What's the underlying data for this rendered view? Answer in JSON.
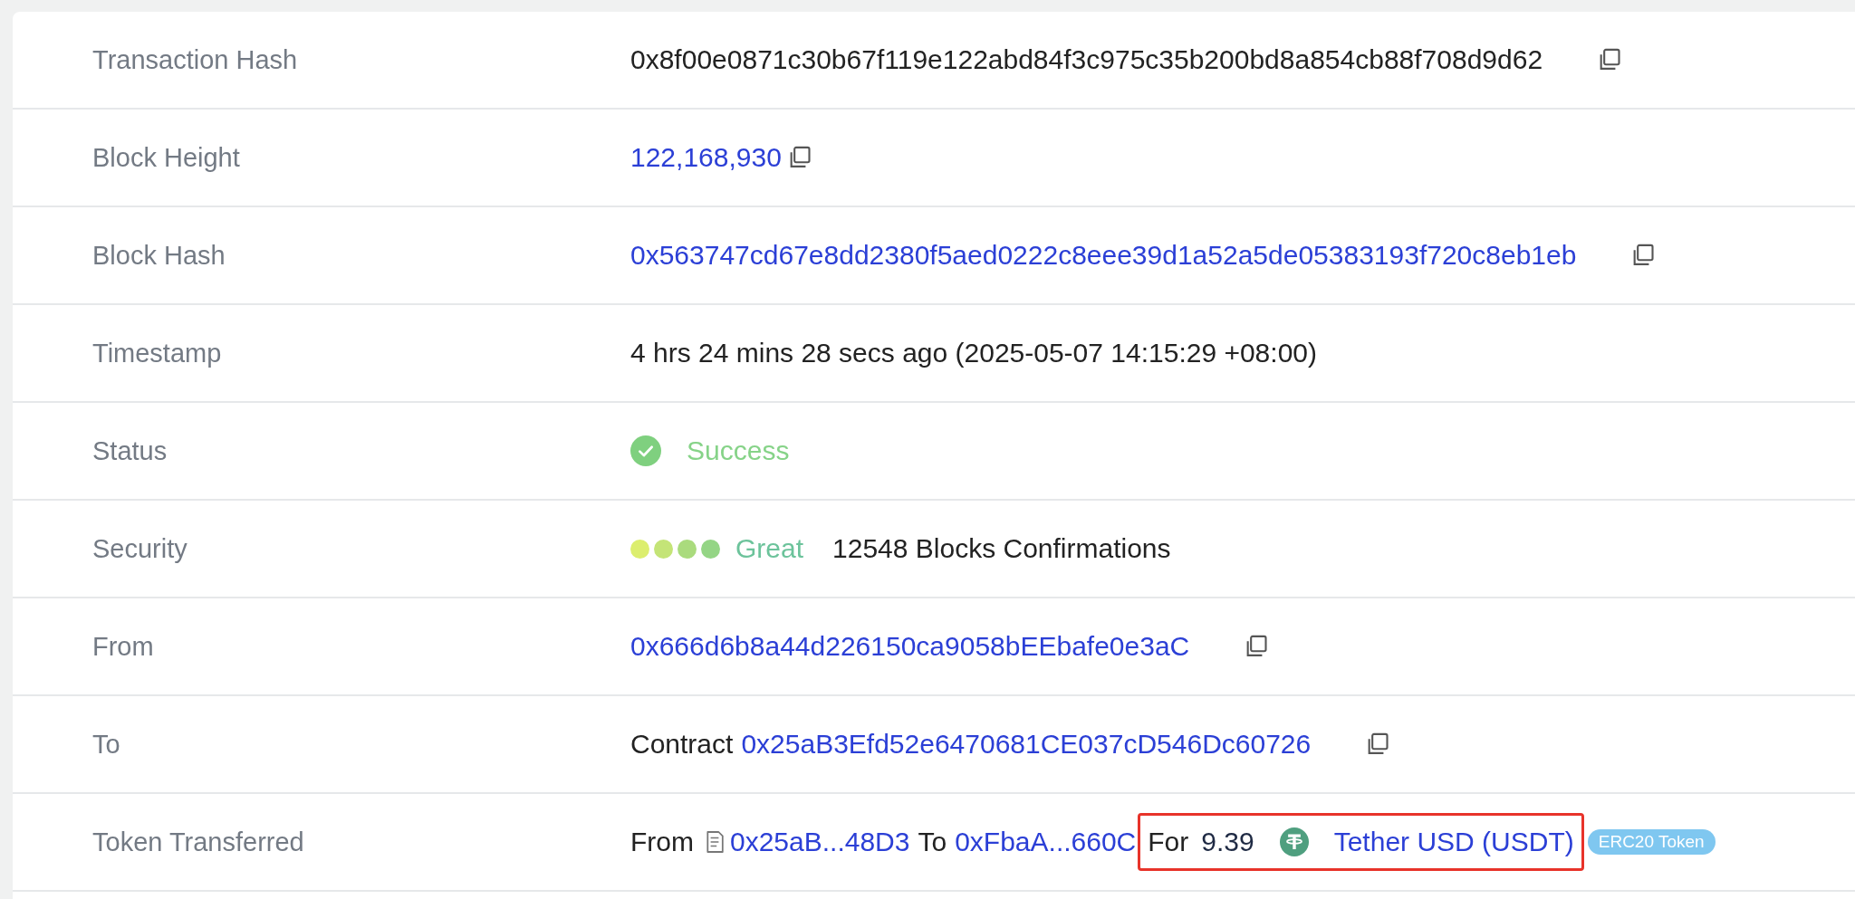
{
  "rows": [
    {
      "label": "Transaction Hash",
      "kind": "text",
      "value": "0x8f00e0871c30b67f119e122abd84f3c975c35b200bd8a854cb88f708d9d62",
      "copy": true
    },
    {
      "label": "Block Height",
      "kind": "number_link",
      "value": "122,168,930",
      "copy": true
    },
    {
      "label": "Block Hash",
      "kind": "link",
      "value": "0x563747cd67e8dd2380f5aed0222c8eee39d1a52a5de05383193f720c8eb1eb",
      "copy": true
    },
    {
      "label": "Timestamp",
      "kind": "text",
      "value": "4 hrs 24 mins 28 secs ago (2025-05-07 14:15:29 +08:00)"
    },
    {
      "label": "Status",
      "kind": "status",
      "value": "Success"
    },
    {
      "label": "Security",
      "kind": "security",
      "dots": [
        {
          "color": "#dcee6e"
        },
        {
          "color": "#c4e477"
        },
        {
          "color": "#aadb7d"
        },
        {
          "color": "#94d585"
        }
      ],
      "rating": "Great",
      "value": "12548 Blocks Confirmations"
    },
    {
      "label": "From",
      "kind": "link",
      "value": "0x666d6b8a44d226150ca9058bEEbafe0e3aC",
      "copy": true
    },
    {
      "label": "To",
      "kind": "contract",
      "prefix": "Contract",
      "value": "0x25aB3Efd52e6470681CE037cD546Dc60726",
      "copy": true
    },
    {
      "label": "Token Transferred",
      "kind": "transfer",
      "from_label": "From",
      "from": "0x25aB...48D3",
      "to_label": "To",
      "to": "0xFbaA...660C",
      "for_label": "For",
      "amount": "9.39",
      "token": "Tether USD (USDT)",
      "badge": "ERC20 Token",
      "highlighted": true
    }
  ]
}
